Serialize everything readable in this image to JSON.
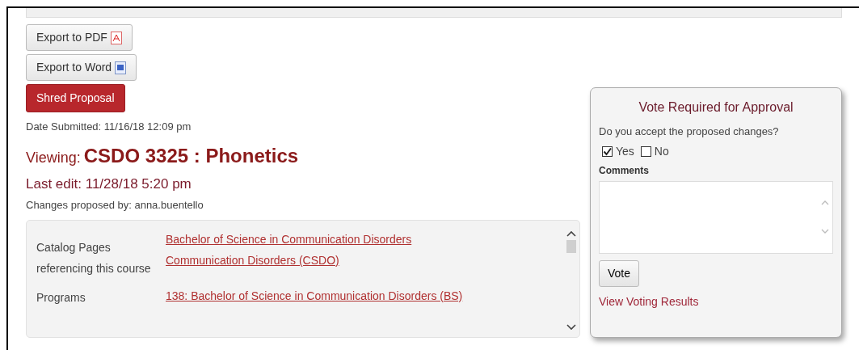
{
  "export_buttons": [
    {
      "label": "Export to PDF",
      "kind": "pdf"
    },
    {
      "label": "Export to Word",
      "kind": "word"
    }
  ],
  "shred_button": {
    "label": "Shred Proposal"
  },
  "date_submitted": "Date Submitted: 11/16/18 12:09 pm",
  "viewing": {
    "label": "Viewing:",
    "course": "CSDO 3325 : Phonetics"
  },
  "last_edit": "Last edit: 11/28/18 5:20 pm",
  "proposed_by": "Changes proposed by: anna.buentello",
  "details": [
    {
      "label": "Catalog Pages referencing this course",
      "links": [
        "Bachelor of Science in Communication Disorders",
        "Communication Disorders (CSDO)"
      ]
    },
    {
      "label": "Programs",
      "links": [
        "138: Bachelor of Science in Communication Disorders (BS)"
      ]
    }
  ],
  "vote_panel": {
    "title": "Vote Required for Approval",
    "question": "Do you accept the proposed changes?",
    "options": [
      {
        "label": "Yes",
        "checked": true
      },
      {
        "label": "No",
        "checked": false
      }
    ],
    "comments_label": "Comments",
    "vote_button": "Vote",
    "results_link": "View Voting Results"
  }
}
